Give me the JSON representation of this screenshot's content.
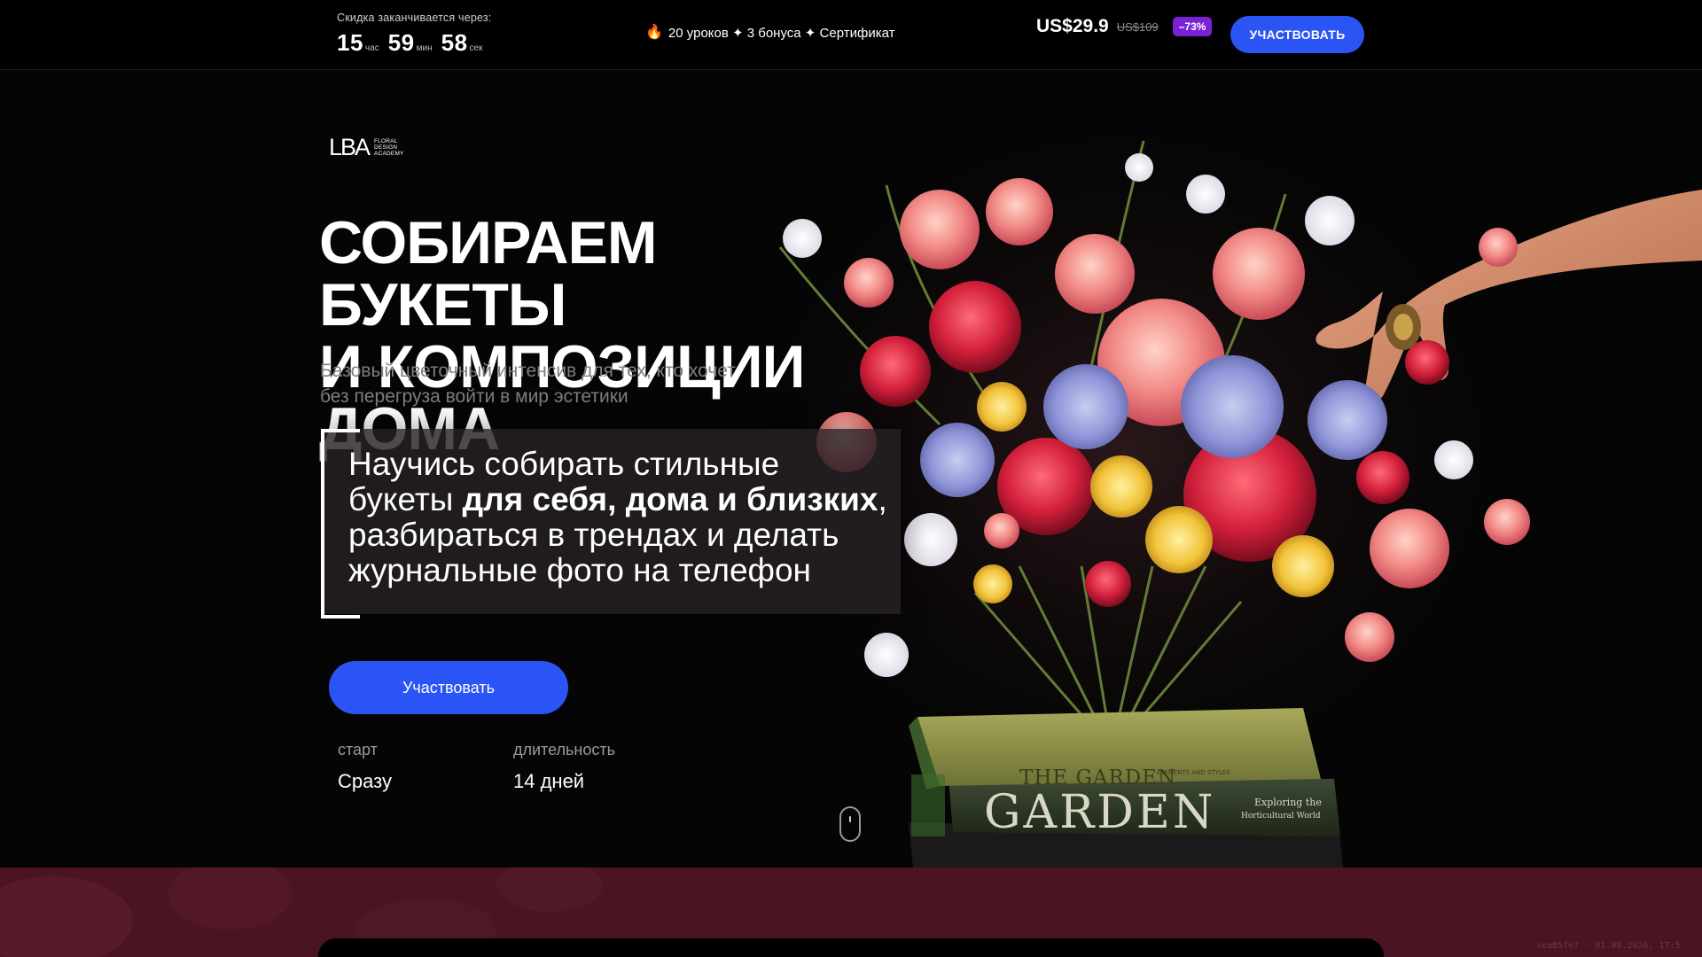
{
  "topbar": {
    "timer_label": "Скидка заканчивается через:",
    "hours": "15",
    "hours_unit": "час",
    "minutes": "59",
    "minutes_unit": "мин",
    "seconds": "58",
    "seconds_unit": "сек",
    "promo_icon": "fire-icon",
    "promo_text": "20 уроков ✦ 3 бонуса ✦ Сертификат",
    "price": "US$29.9",
    "old_price": "US$109",
    "discount": "–73%",
    "cta_label": "УЧАСТВОВАТЬ"
  },
  "hero": {
    "logo_mark": "LBA",
    "logo_sub": [
      "FLORAL",
      "DESIGN",
      "ACADEMY"
    ],
    "headline": [
      "СОБИРАЕМ",
      "БУКЕТЫ",
      "И КОМПОЗИЦИИ",
      "ДОМА"
    ],
    "subtitle": [
      "Базовый цветочный интенсив для тех, кто хочет",
      "без перегруза войти в мир эстетики"
    ],
    "glass_line1": "Научись собирать стильные",
    "glass_line2_start": "букеты ",
    "glass_line2_bold": "для себя, дома и близких",
    "glass_line2_end": ",",
    "glass_line3": "разбираться в трендах и делать",
    "glass_line4": "журнальные фото на телефон",
    "cta_label": "Участвовать",
    "start_label": "старт",
    "start_value": "Сразу",
    "duration_label": "длительность",
    "duration_value": "14 дней",
    "book_top": "THE GARDEN",
    "book_top_small": "ELEMENTS AND STYLES",
    "book_bottom": "GARDEN",
    "book_bottom_small1": "Exploring the",
    "book_bottom_small2": "Horticultural World"
  },
  "footer_mark": "vea85fe7 · 01.08.2026, 17:5"
}
